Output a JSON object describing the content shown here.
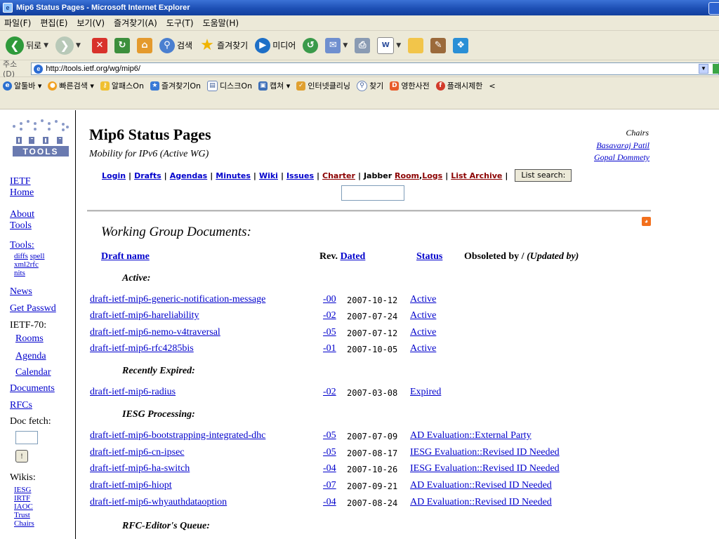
{
  "window": {
    "title": "Mip6 Status Pages - Microsoft Internet Explorer"
  },
  "menu": [
    "파일(F)",
    "편집(E)",
    "보기(V)",
    "즐겨찾기(A)",
    "도구(T)",
    "도움말(H)"
  ],
  "toolbar": {
    "back_label": "뒤로",
    "search_label": "검색",
    "favorites_label": "즐겨찾기",
    "media_label": "미디어"
  },
  "address": {
    "label": "주소(D)",
    "url": "http://tools.ietf.org/wg/mip6/"
  },
  "links_bar": [
    "알툴바",
    "빠른검색",
    "알패스On",
    "즐겨찾기On",
    "디스크On",
    "캡쳐",
    "인터넷클리닝",
    "찾기",
    "영한사전",
    "플래시제한",
    "<"
  ],
  "sidebar": {
    "logo_text": "I E T F  TOOLS",
    "ietf_home_1": "IETF",
    "ietf_home_2": "Home",
    "about_1": "About",
    "about_2": "Tools",
    "tools": "Tools:",
    "diffs": "diffs",
    "spell": "spell",
    "xml2rfc": "xml2rfc",
    "nits": "nits",
    "news": "News",
    "get_passwd": "Get Passwd",
    "ietf70": "IETF-70:",
    "rooms": "Rooms",
    "agenda": "Agenda",
    "calendar": "Calendar",
    "documents": "Documents",
    "rfcs": "RFCs",
    "doc_fetch": "Doc fetch:",
    "wikis": "Wikis:",
    "iesg": "IESG",
    "irtf": "IRTF",
    "iaoc": "IAOC",
    "trust": "Trust",
    "chairs": "Chairs"
  },
  "header": {
    "title": "Mip6 Status Pages",
    "subtitle": "Mobility for IPv6 (Active WG)",
    "chairs_label": "Chairs",
    "chairs": [
      "Basavaraj Patil",
      "Gopal Dommety"
    ]
  },
  "nav": {
    "login": "Login",
    "drafts": "Drafts",
    "agendas": "Agendas",
    "minutes": "Minutes",
    "wiki": "Wiki",
    "issues": "Issues",
    "charter": "Charter",
    "jabber": "Jabber",
    "room": "Room",
    "logs": "Logs",
    "list_archive": "List Archive",
    "list_search": "List search:"
  },
  "docs": {
    "heading": "Working Group Documents:",
    "col_name": "Draft name",
    "col_rev": "Rev.",
    "col_dated": "Dated",
    "col_status": "Status",
    "col_obsoleted": "Obsoleted by /",
    "col_updated": "(Updated by)",
    "sections": {
      "active": {
        "label": "Active:",
        "rows": [
          {
            "name": "draft-ietf-mip6-generic-notification-message",
            "rev": "-00",
            "date": "2007-10-12",
            "status": "Active"
          },
          {
            "name": "draft-ietf-mip6-hareliability",
            "rev": "-02",
            "date": "2007-07-24",
            "status": "Active"
          },
          {
            "name": "draft-ietf-mip6-nemo-v4traversal",
            "rev": "-05",
            "date": "2007-07-12",
            "status": "Active"
          },
          {
            "name": "draft-ietf-mip6-rfc4285bis",
            "rev": "-01",
            "date": "2007-10-05",
            "status": "Active"
          }
        ]
      },
      "expired": {
        "label": "Recently Expired:",
        "rows": [
          {
            "name": "draft-ietf-mip6-radius",
            "rev": "-02",
            "date": "2007-03-08",
            "status": "Expired"
          }
        ]
      },
      "iesg": {
        "label": "IESG Processing:",
        "rows": [
          {
            "name": "draft-ietf-mip6-bootstrapping-integrated-dhc",
            "rev": "-05",
            "date": "2007-07-09",
            "status": "AD Evaluation::External Party"
          },
          {
            "name": "draft-ietf-mip6-cn-ipsec",
            "rev": "-05",
            "date": "2007-08-17",
            "status": "IESG Evaluation::Revised ID Needed"
          },
          {
            "name": "draft-ietf-mip6-ha-switch",
            "rev": "-04",
            "date": "2007-10-26",
            "status": "IESG Evaluation::Revised ID Needed"
          },
          {
            "name": "draft-ietf-mip6-hiopt",
            "rev": "-07",
            "date": "2007-09-21",
            "status": "AD Evaluation::Revised ID Needed"
          },
          {
            "name": "draft-ietf-mip6-whyauthdataoption",
            "rev": "-04",
            "date": "2007-08-24",
            "status": "AD Evaluation::Revised ID Needed"
          }
        ]
      },
      "rfc_queue": {
        "label": "RFC-Editor's Queue:"
      }
    }
  }
}
